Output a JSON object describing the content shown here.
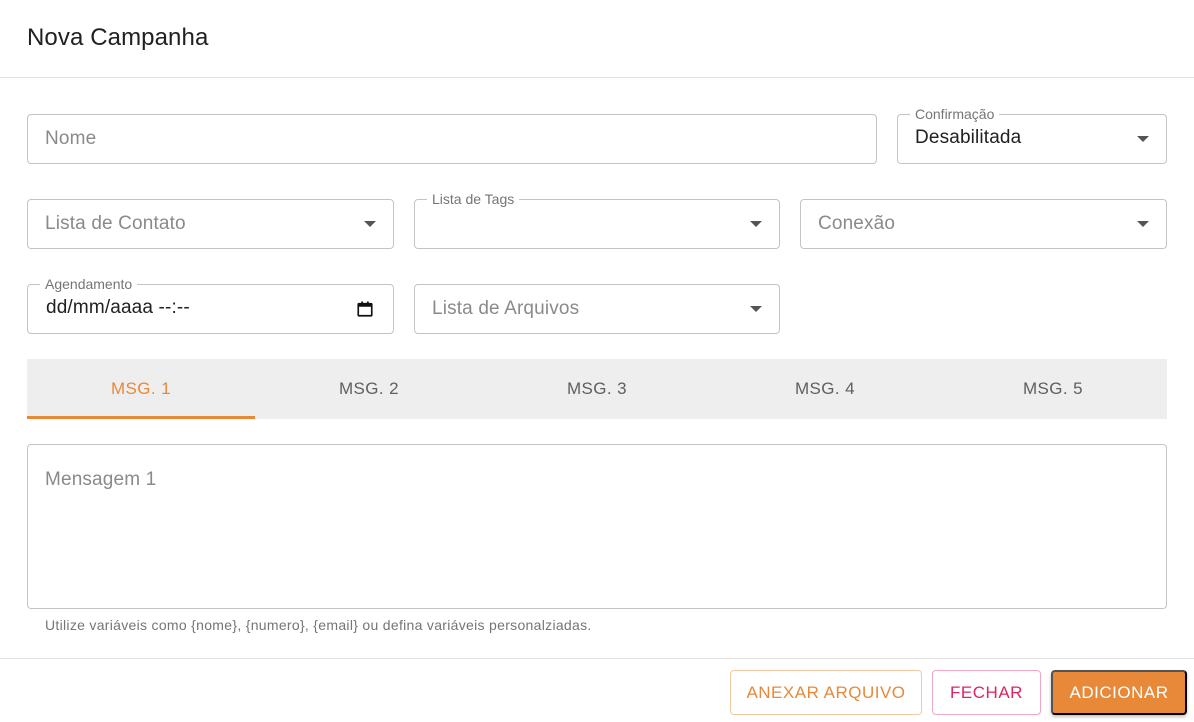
{
  "dialog": {
    "title": "Nova Campanha"
  },
  "form": {
    "nome": {
      "placeholder": "Nome"
    },
    "confirmacao": {
      "label": "Confirmação",
      "value": "Desabilitada"
    },
    "lista_contato": {
      "placeholder": "Lista de Contato"
    },
    "lista_tags": {
      "label": "Lista de Tags",
      "value": ""
    },
    "conexao": {
      "placeholder": "Conexão"
    },
    "agendamento": {
      "label": "Agendamento",
      "value": "dd/mm/aaaa --:--"
    },
    "lista_arquivos": {
      "placeholder": "Lista de Arquivos"
    }
  },
  "tabs": [
    {
      "label": "MSG. 1",
      "active": true
    },
    {
      "label": "MSG. 2",
      "active": false
    },
    {
      "label": "MSG. 3",
      "active": false
    },
    {
      "label": "MSG. 4",
      "active": false
    },
    {
      "label": "MSG. 5",
      "active": false
    }
  ],
  "message": {
    "placeholder": "Mensagem 1",
    "helper": "Utilize variáveis como {nome}, {numero}, {email} ou defina variáveis personalziadas."
  },
  "actions": {
    "attach_label": "ANEXAR ARQUIVO",
    "close_label": "FECHAR",
    "add_label": "ADICIONAR"
  },
  "colors": {
    "accent": "#e8893a",
    "secondary": "#e0245e",
    "tab_bar_bg": "#eeeeee"
  }
}
